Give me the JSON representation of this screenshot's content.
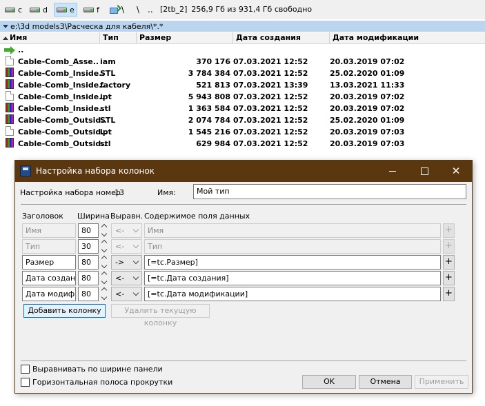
{
  "drives": [
    {
      "letter": "c"
    },
    {
      "letter": "d"
    },
    {
      "letter": "e",
      "active": true
    },
    {
      "letter": "f"
    }
  ],
  "nav": {
    "backslash": "\\",
    "dotdot": ".."
  },
  "disk_info": {
    "label": "[2tb_2]",
    "free_text": "256,9 Гб из 931,4 Гб свободно"
  },
  "path": "e:\\3d models3\\Расческа для кабеля\\*.*",
  "columns": {
    "name": "Имя",
    "type": "Тип",
    "size": "Размер",
    "created": "Дата создания",
    "modified": "Дата модификации"
  },
  "files": [
    {
      "icon": "up-arrow-icon",
      "name": "..",
      "type": "",
      "size": "",
      "created": "",
      "modified": ""
    },
    {
      "icon": "document-icon",
      "name": "Cable-Comb_Asse..",
      "type": "iam",
      "size": "370 176",
      "created": "07.03.2021 12:52",
      "modified": "20.03.2019 07:02"
    },
    {
      "icon": "cad-file-icon",
      "name": "Cable-Comb_Inside..",
      "type": "STL",
      "size": "3 784 384",
      "created": "07.03.2021 12:52",
      "modified": "25.02.2020 01:09"
    },
    {
      "icon": "cad-file-icon",
      "name": "Cable-Comb_Inside..",
      "type": "factory",
      "size": "521 813",
      "created": "07.03.2021 13:39",
      "modified": "13.03.2021 11:33"
    },
    {
      "icon": "document-icon",
      "name": "Cable-Comb_Inside..",
      "type": "ipt",
      "size": "5 943 808",
      "created": "07.03.2021 12:52",
      "modified": "20.03.2019 07:02"
    },
    {
      "icon": "cad-file-icon",
      "name": "Cable-Comb_Inside..",
      "type": "stl",
      "size": "1 363 584",
      "created": "07.03.2021 12:52",
      "modified": "20.03.2019 07:02"
    },
    {
      "icon": "cad-file-icon",
      "name": "Cable-Comb_Outsid..",
      "type": "STL",
      "size": "2 074 784",
      "created": "07.03.2021 12:52",
      "modified": "25.02.2020 01:09"
    },
    {
      "icon": "document-icon",
      "name": "Cable-Comb_Outsid..",
      "type": "ipt",
      "size": "1 545 216",
      "created": "07.03.2021 12:52",
      "modified": "20.03.2019 07:03"
    },
    {
      "icon": "cad-file-icon",
      "name": "Cable-Comb_Outsid..",
      "type": "stl",
      "size": "629 984",
      "created": "07.03.2021 12:52",
      "modified": "20.03.2019 07:03"
    }
  ],
  "dialog": {
    "title": "Настройка набора колонок",
    "set_number_label": "Настройка набора номер",
    "set_number": "13",
    "name_label": "Имя:",
    "name_value": "Мой тип",
    "col_headers": {
      "header": "Заголовок",
      "width": "Ширина",
      "align": "Выравн.",
      "content": "Содержимое поля данных"
    },
    "rows": [
      {
        "header": "Имя",
        "width": "80",
        "align": "<-",
        "content": "Имя",
        "disabled": true
      },
      {
        "header": "Тип",
        "width": "30",
        "align": "<-",
        "content": "Тип",
        "disabled": true
      },
      {
        "header": "Размер",
        "width": "80",
        "align": "->",
        "content": "[=tc.Размер]",
        "disabled": false
      },
      {
        "header": "Дата создани",
        "width": "80",
        "align": "<-",
        "content": "[=tc.Дата создания]",
        "disabled": false
      },
      {
        "header": "Дата модифик",
        "width": "80",
        "align": "<-",
        "content": "[=tc.Дата модификации]",
        "disabled": false
      }
    ],
    "plus": "+",
    "add_column": "Добавить колонку",
    "remove_column": "Удалить текущую колонку",
    "fit_width": "Выравнивать по ширине панели",
    "hscroll": "Горизонтальная полоса прокрутки",
    "ok": "OK",
    "cancel": "Отмена",
    "apply": "Применить"
  }
}
